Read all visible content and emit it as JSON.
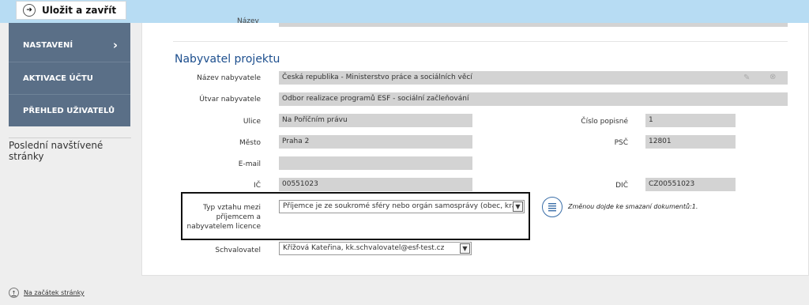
{
  "toolbar": {
    "save_close_label": "Uložit a zavřít"
  },
  "sidebar": {
    "items": [
      {
        "label": "NASTAVENÍ",
        "has_chevron": true
      },
      {
        "label": "AKTIVACE ÚČTU"
      },
      {
        "label": "PŘEHLED UŽIVATELŮ"
      }
    ],
    "recent_pages_title": "Poslední navštívené stránky"
  },
  "form": {
    "top_label_partial": "Název",
    "section_title": "Nabyvatel projektu",
    "nazev_nabyvatele": {
      "label": "Název nabyvatele",
      "value": "Česká republika - Ministerstvo práce a sociálních věcí"
    },
    "utvar_nabyvatele": {
      "label": "Útvar nabyvatele",
      "value": "Odbor realizace programů ESF - sociální začleňování"
    },
    "ulice": {
      "label": "Ulice",
      "value": "Na Poříčním právu"
    },
    "cislo_popisne": {
      "label": "Číslo popisné",
      "value": "1"
    },
    "mesto": {
      "label": "Město",
      "value": "Praha 2"
    },
    "psc": {
      "label": "PSČ",
      "value": "12801"
    },
    "email": {
      "label": "E-mail",
      "value": ""
    },
    "ic": {
      "label": "IČ",
      "value": "00551023"
    },
    "dic": {
      "label": "DIČ",
      "value": "CZ00551023"
    },
    "typ_vztahu": {
      "label_lines": [
        "Typ vztahu mezi",
        "příjemcem a",
        "nabyvatelem licence"
      ],
      "value": "Příjemce je ze soukromé sféry nebo orgán samosprávy (obec, kraj)"
    },
    "document_note": "Změnou dojde ke smazaní dokumentů:1.",
    "schvalovatel": {
      "label": "Schvalovatel",
      "value": "Křížová Kateřina, kk.schvalovatel@esf-test.cz"
    }
  },
  "footer": {
    "back_to_top": "Na začátek stránky"
  }
}
